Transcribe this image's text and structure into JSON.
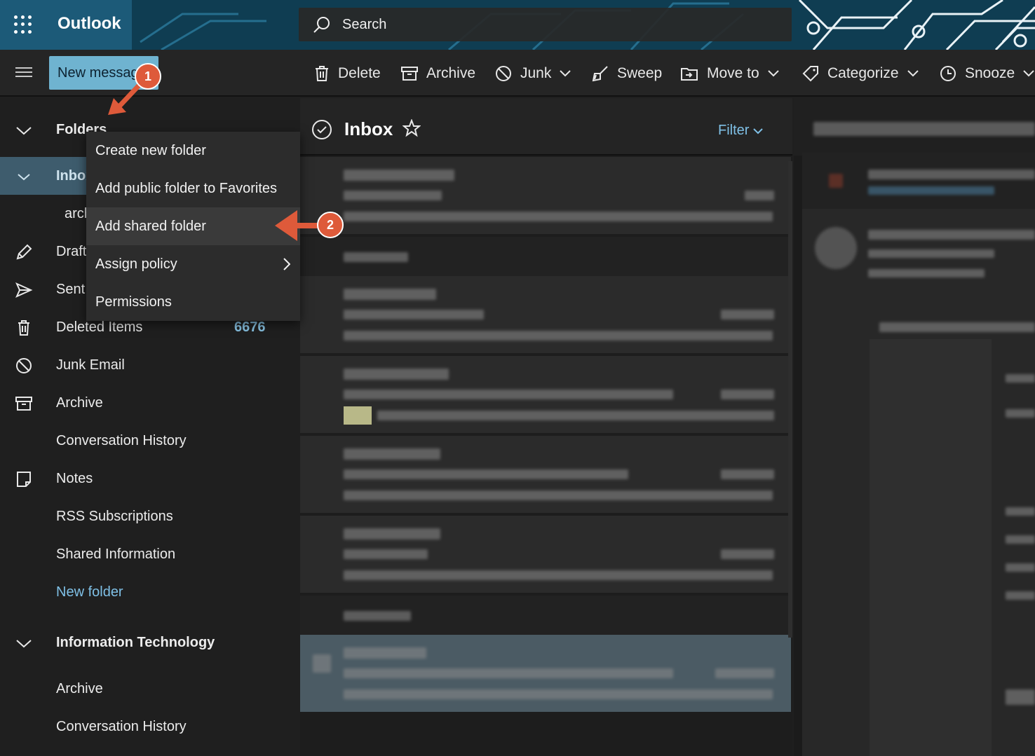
{
  "app": {
    "title": "Outlook"
  },
  "search": {
    "placeholder": "Search"
  },
  "command_bar": {
    "new_message_label": "New message",
    "actions": {
      "delete": "Delete",
      "archive": "Archive",
      "junk": "Junk",
      "sweep": "Sweep",
      "move_to": "Move to",
      "categorize": "Categorize",
      "snooze": "Snooze"
    }
  },
  "sidebar": {
    "folders_header": "Folders",
    "items": {
      "inbox": "Inbox",
      "archive_sub": "archive",
      "drafts": "Drafts",
      "sent": "Sent Items",
      "deleted": "Deleted Items",
      "deleted_count": "6676",
      "junk": "Junk Email",
      "archive": "Archive",
      "conversation_history": "Conversation History",
      "notes": "Notes",
      "rss": "RSS Subscriptions",
      "shared_information": "Shared Information",
      "new_folder": "New folder"
    },
    "group2": {
      "header": "Information Technology",
      "archive": "Archive",
      "conversation_history": "Conversation History"
    }
  },
  "context_menu": {
    "create_new_folder": "Create new folder",
    "add_public_folder": "Add public folder to Favorites",
    "add_shared_folder": "Add shared folder",
    "assign_policy": "Assign policy",
    "permissions": "Permissions"
  },
  "message_list": {
    "title": "Inbox",
    "filter_label": "Filter"
  },
  "annotations": {
    "step1": "1",
    "step2": "2"
  },
  "colors": {
    "accent": "#6fb3d0",
    "link": "#7fc0e6",
    "badge": "#de5a3a",
    "selected_row": "#3e5c6d"
  }
}
